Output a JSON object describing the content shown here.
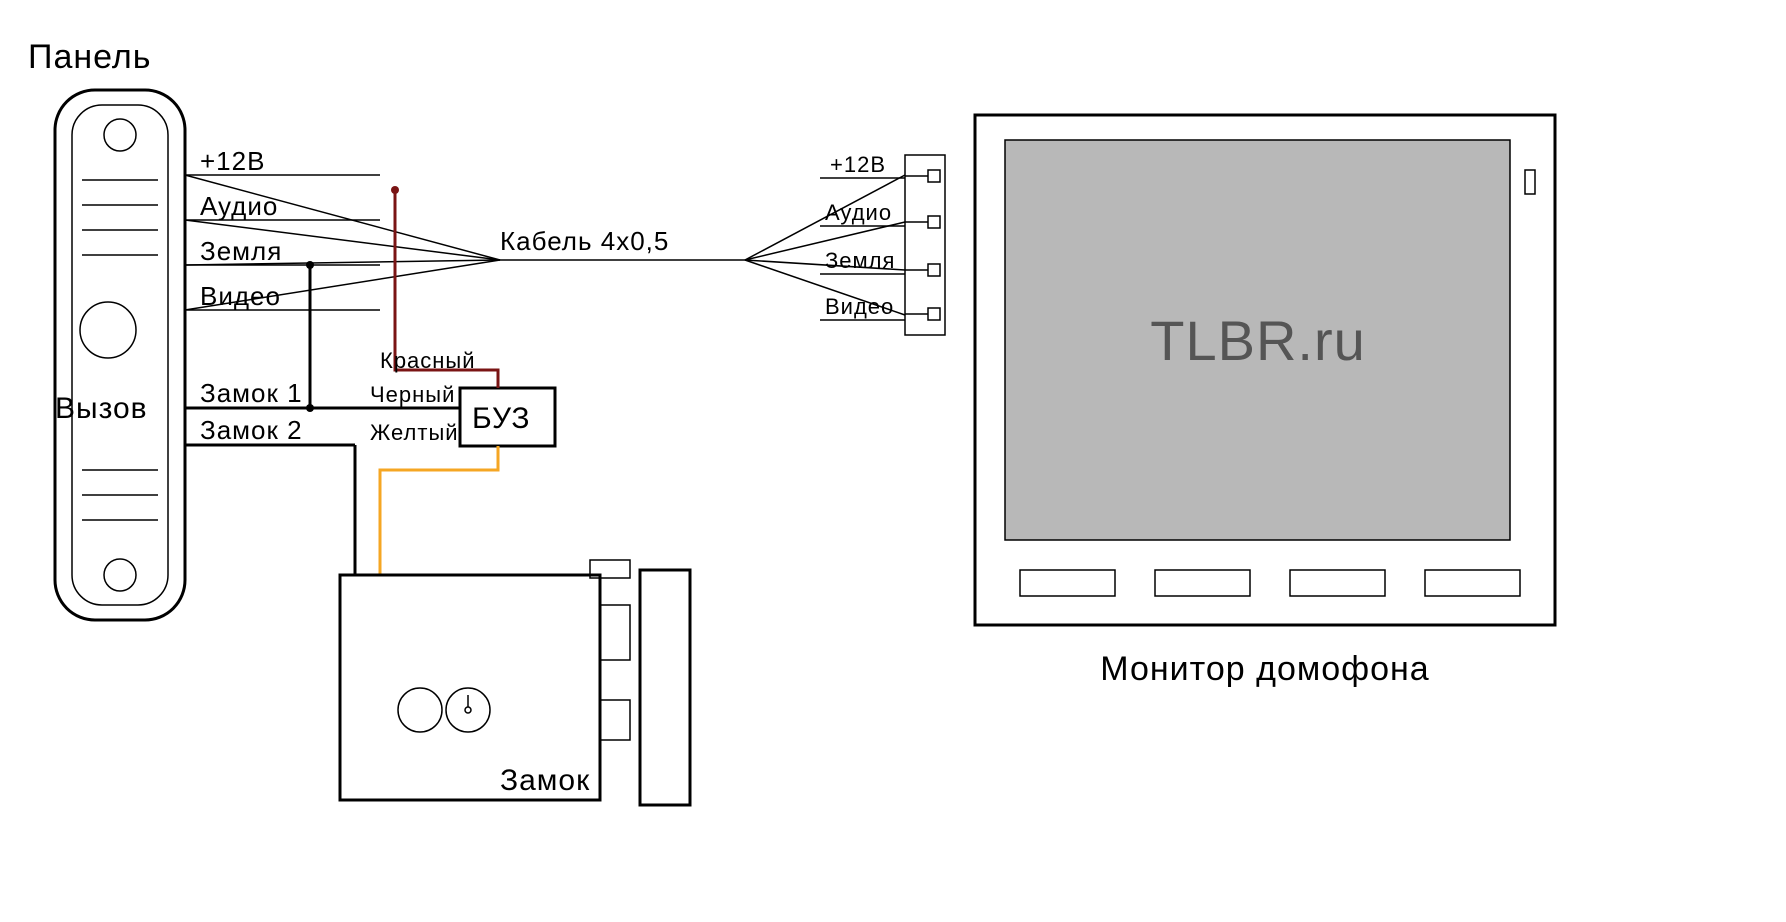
{
  "labels": {
    "panel_title": "Панель",
    "call_button": "Вызов",
    "sig_12v": "+12В",
    "sig_audio": "Аудио",
    "sig_gnd": "Земля",
    "sig_video": "Видео",
    "cable": "Кабель 4х0,5",
    "lock1": "Замок 1",
    "lock2": "Замок 2",
    "wire_red": "Красный",
    "wire_black": "Черный",
    "wire_yellow": "Желтый",
    "buz": "БУЗ",
    "lock_label": "Замок",
    "monitor_title": "Монитор домофона",
    "screen_text": "TLBR.ru"
  },
  "monitor": {
    "term_12v": "+12В",
    "term_audio": "Аудио",
    "term_gnd": "Земля",
    "term_video": "Видео"
  },
  "colors": {
    "red_wire": "#7a1414",
    "black_wire": "#000000",
    "yellow_wire": "#f5a623",
    "screen_fill": "#b8b8b8"
  }
}
